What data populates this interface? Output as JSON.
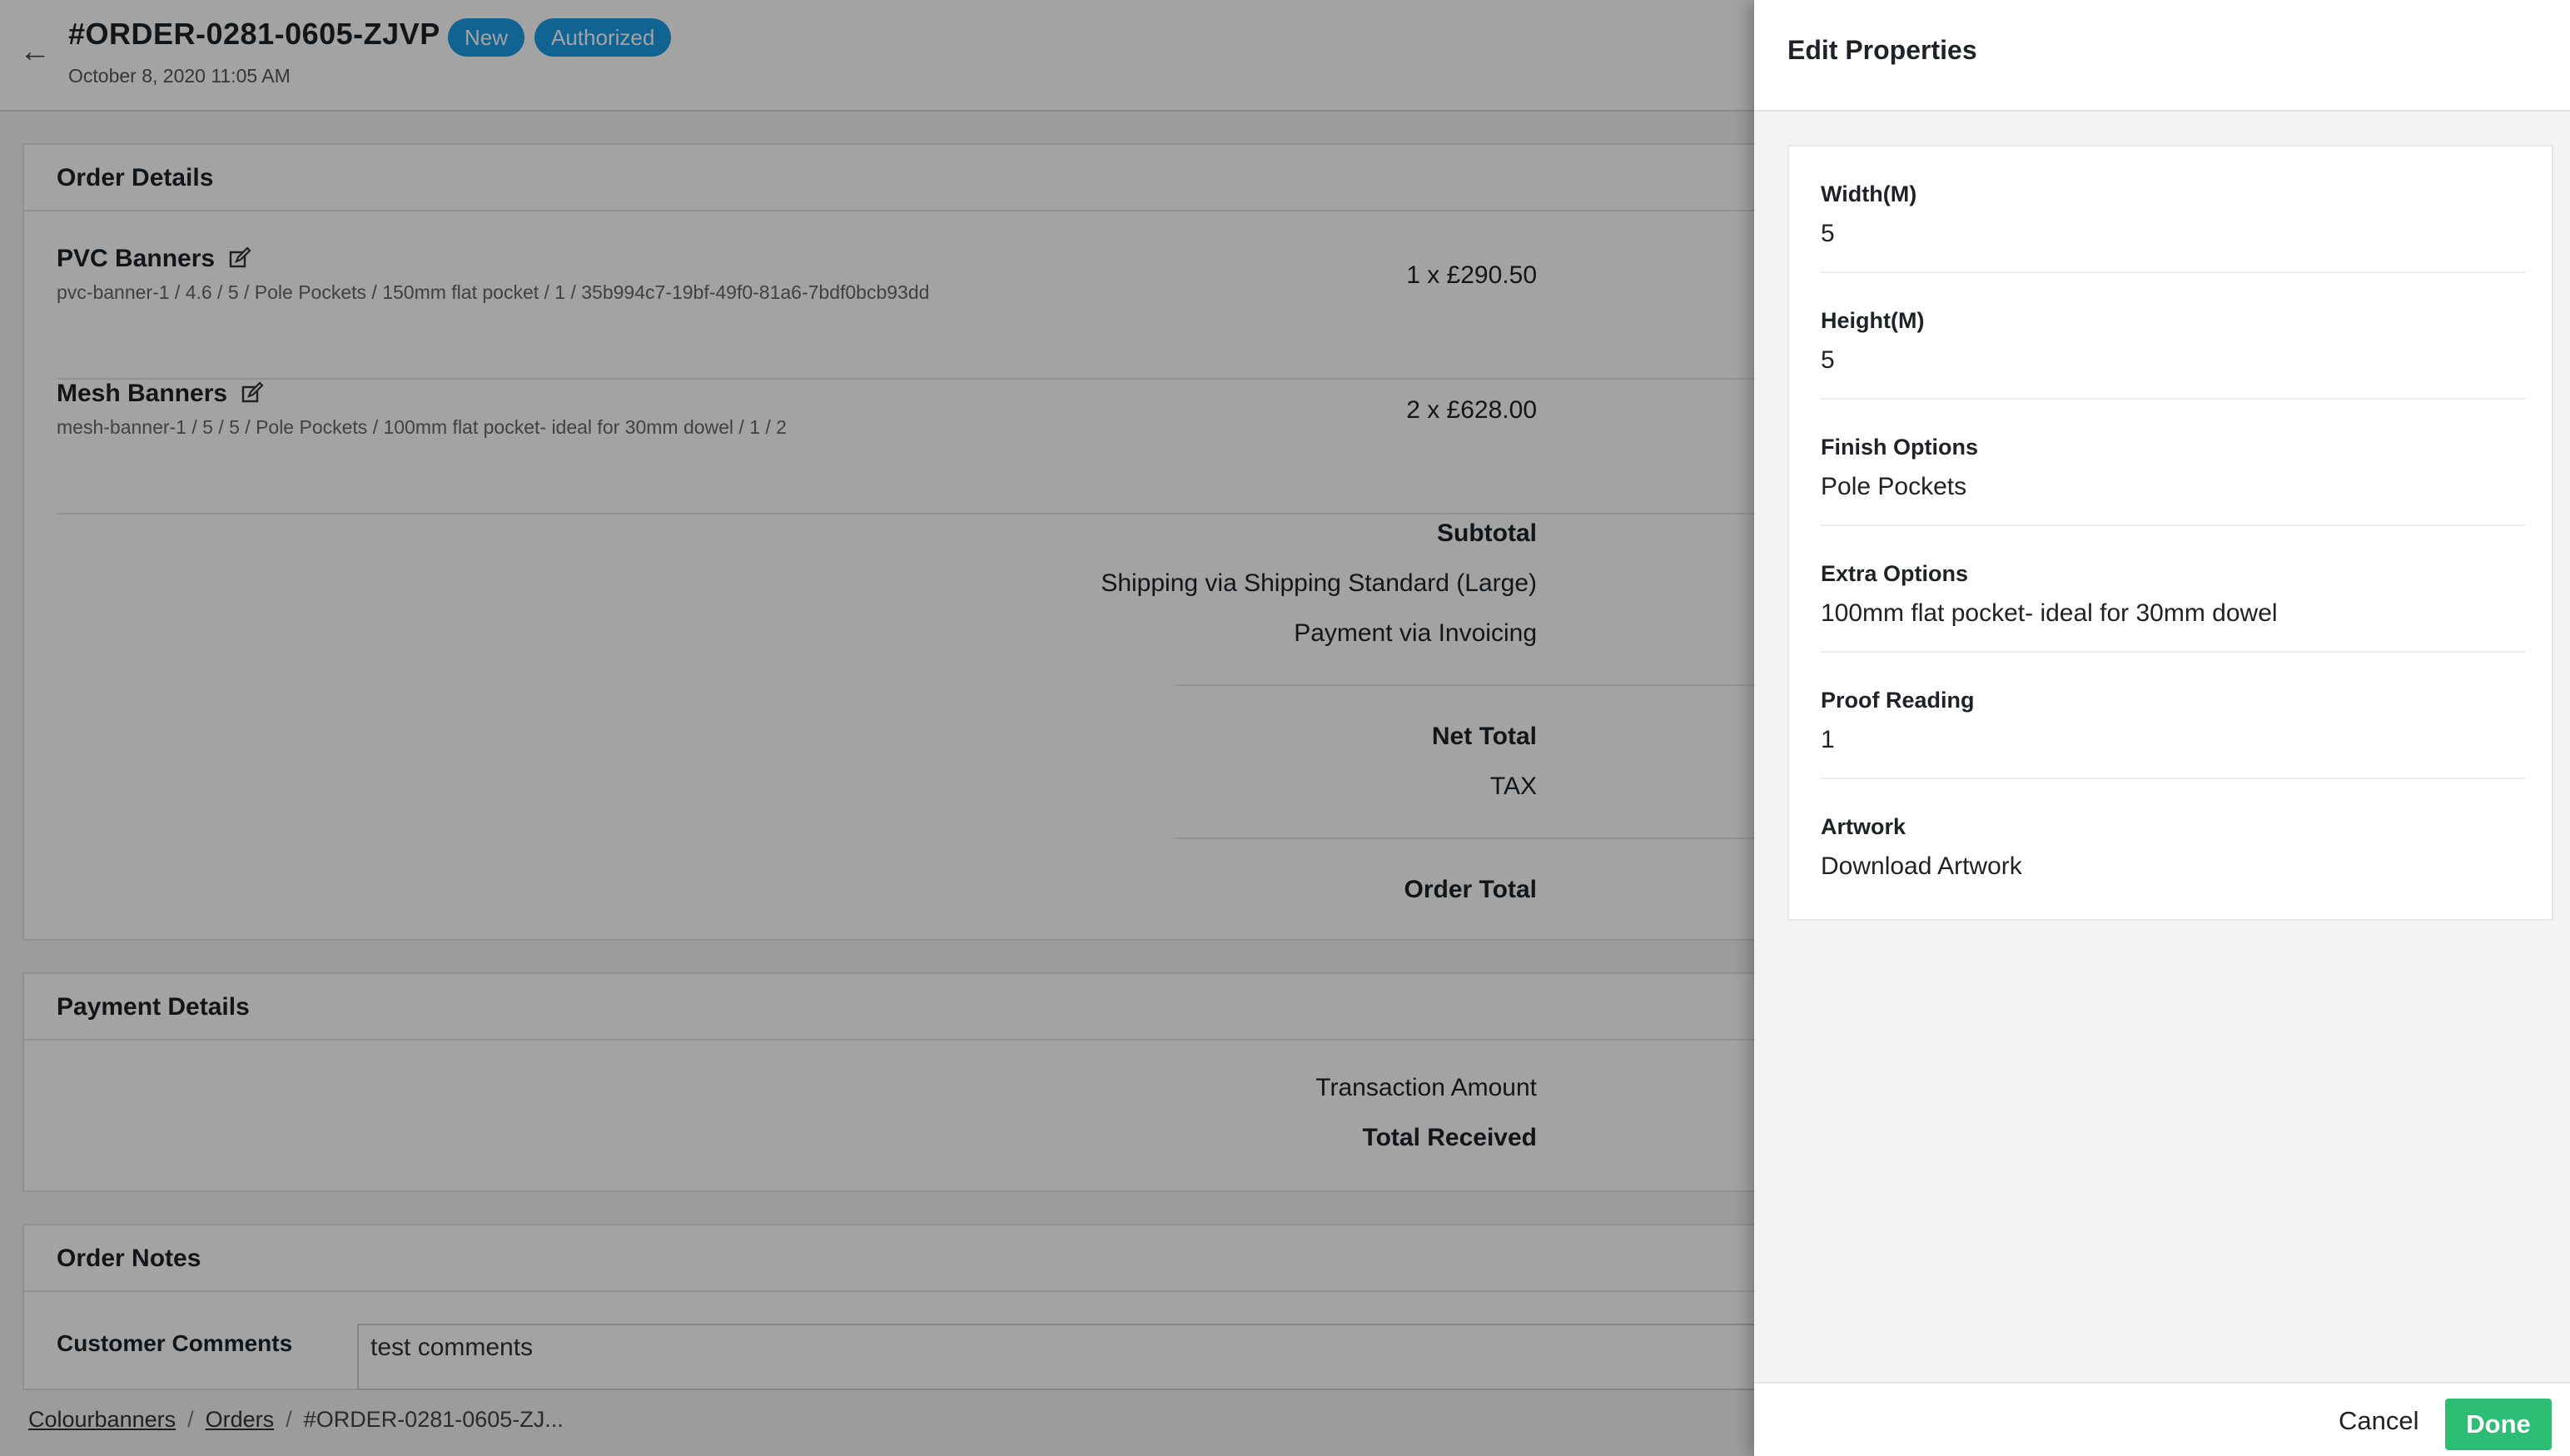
{
  "order": {
    "title": "#ORDER-0281-0605-ZJVP",
    "badges": [
      "New",
      "Authorized"
    ],
    "date": "October 8, 2020 11:05 AM"
  },
  "order_details": {
    "heading": "Order Details",
    "items": [
      {
        "name": "PVC Banners",
        "meta": "pvc-banner-1  / 4.6 / 5 / Pole Pockets / 150mm flat pocket / 1 / 35b994c7-19bf-49f0-81a6-7bdf0bcb93dd",
        "qty_price": "1 x £290.50"
      },
      {
        "name": "Mesh Banners",
        "meta": "mesh-banner-1  / 5 / 5 / Pole Pockets / 100mm flat pocket- ideal for 30mm dowel / 1 / 2",
        "qty_price": "2 x £628.00"
      }
    ],
    "subtotal_label": "Subtotal",
    "shipping_label": "Shipping via Shipping Standard (Large)",
    "payment_label": "Payment via Invoicing",
    "net_total_label": "Net Total",
    "tax_label": "TAX",
    "order_total_label": "Order Total"
  },
  "payment_details": {
    "heading": "Payment Details",
    "transaction_label": "Transaction Amount",
    "total_received_label": "Total Received"
  },
  "order_notes": {
    "heading": "Order Notes",
    "customer_comments_label": "Customer Comments",
    "customer_comments_value": "test comments"
  },
  "breadcrumb": {
    "items": [
      "Colourbanners",
      "Orders",
      "#ORDER-0281-0605-ZJ..."
    ]
  },
  "panel": {
    "title": "Edit Properties",
    "properties": [
      {
        "label": "Width(M)",
        "value": "5"
      },
      {
        "label": "Height(M)",
        "value": "5"
      },
      {
        "label": "Finish Options",
        "value": "Pole Pockets"
      },
      {
        "label": "Extra Options",
        "value": "100mm flat pocket- ideal for 30mm dowel"
      },
      {
        "label": "Proof Reading",
        "value": "1"
      },
      {
        "label": "Artwork",
        "value": "Download Artwork"
      }
    ],
    "cancel_label": "Cancel",
    "done_label": "Done"
  },
  "colors": {
    "badge": "#1b9ce5",
    "done_button": "#2dbd75"
  },
  "icons": [
    "back-arrow-icon",
    "edit-icon"
  ]
}
